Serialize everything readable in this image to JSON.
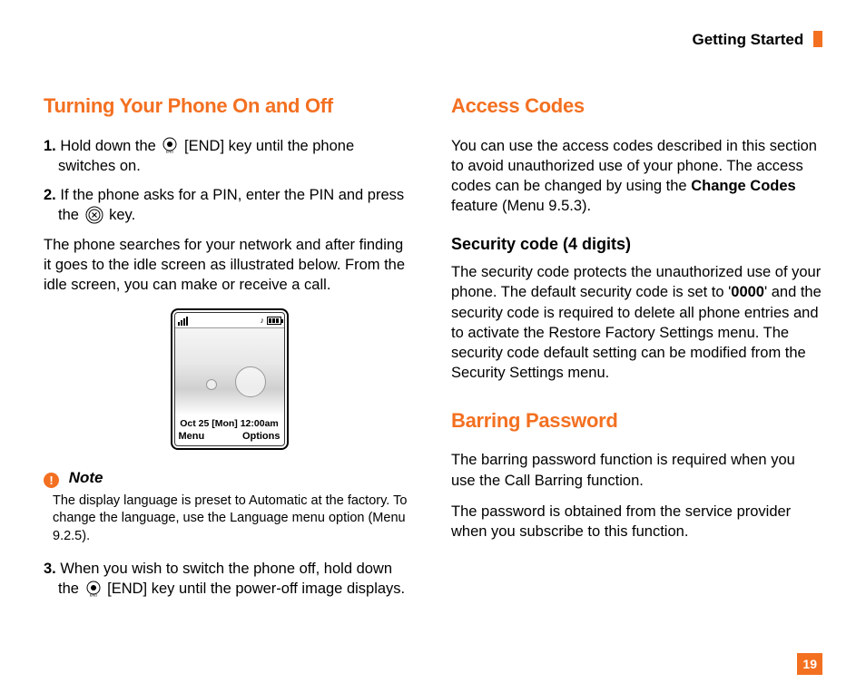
{
  "header": {
    "section": "Getting Started"
  },
  "left": {
    "heading": "Turning Your Phone On and Off",
    "step1_a": "1.",
    "step1_b": "Hold down the ",
    "step1_c": " [END] key until the phone switches on.",
    "step2_a": "2.",
    "step2_b": "If the phone asks for a PIN, enter the PIN and press the ",
    "step2_c": " key.",
    "para1": "The phone searches for your network and after finding it goes to the idle screen as illustrated below. From the idle screen, you can make or receive a call.",
    "phone": {
      "date": "Oct 25 [Mon] 12:00am",
      "softkey_left": "Menu",
      "softkey_right": "Options"
    },
    "note_label": "Note",
    "note_body": "The display language is preset to Automatic at the factory. To change the language, use the Language menu option (Menu 9.2.5).",
    "step3_a": "3.",
    "step3_b": "When you wish to switch the phone off, hold down the ",
    "step3_c": " [END] key until the power-off image displays."
  },
  "right": {
    "heading1": "Access Codes",
    "para1_a": "You can use the access codes described in this section to avoid unauthorized use of your phone. The access codes can be changed by using the ",
    "para1_bold": "Change Codes",
    "para1_b": " feature (Menu 9.5.3).",
    "sub1": "Security code (4 digits)",
    "para2_a": "The security code protects the unauthorized use of your phone. The default security code is set to '",
    "para2_bold": "0000",
    "para2_b": "' and the security code is required to delete all phone entries and to activate the Restore Factory Settings menu. The security code default setting can be modified from the Security Settings menu.",
    "heading2": "Barring Password",
    "para3": "The barring password function is required when you use the Call Barring function.",
    "para4": "The password is obtained from the service provider when you subscribe to this function."
  },
  "page_number": "19"
}
